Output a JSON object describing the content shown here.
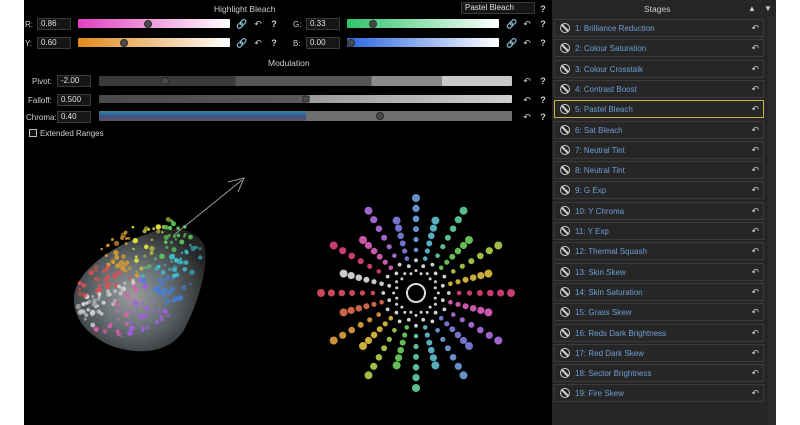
{
  "header": {
    "title": "Highlight Bleach",
    "preset_value": "Pastel Bleach",
    "help": "?"
  },
  "channels": {
    "r": {
      "label": "R:",
      "value": "0.86",
      "gradient_from": "#e040c0",
      "gradient_to": "#ffffff",
      "level": 0.46
    },
    "g": {
      "label": "G:",
      "value": "0.33",
      "gradient_from": "#2ec46a",
      "gradient_to": "#ffffff",
      "level": 0.17
    },
    "y": {
      "label": "Y:",
      "value": "0.60",
      "gradient_from": "#e08a1a",
      "gradient_to": "#ffffff",
      "level": 0.3
    },
    "b": {
      "label": "B:",
      "value": "0.00",
      "gradient_from": "#2a66e0",
      "gradient_to": "#ffffff",
      "level": 0.0
    }
  },
  "modulation": {
    "title": "Modulation",
    "pivot": {
      "label": "Pivot:",
      "value": "-2.00",
      "level": 0.16
    },
    "falloff": {
      "label": "Falloff:",
      "value": "0.500",
      "level": 0.5
    },
    "chroma": {
      "label": "Chroma:",
      "value": "0.40",
      "level": 0.68
    }
  },
  "extended_ranges": {
    "label": "Extended Ranges",
    "checked": false
  },
  "icons": {
    "link": "link-icon",
    "undo": "undo-icon",
    "help": "help-icon",
    "disabled": "disabled-icon"
  },
  "stages": {
    "title": "Stages",
    "up": "▲",
    "down": "▼",
    "selected_index": 4,
    "items": [
      "1: Brilliance Reduction",
      "2: Colour Saturation",
      "3: Colour Crosstalk",
      "4: Contrast Boost",
      "5: Pastel Bleach",
      "6: Sat Bleach",
      "7: Neutral Tint",
      "8: Neutral Tint",
      "9: G Exp",
      "10: Y Chroma",
      "11: Y Exp",
      "12: Thermal Squash",
      "13: Skin Skew",
      "14: Skin Saturation",
      "15: Grass Skew",
      "16: Reds Dark Brightness",
      "17: Red Dark Skew",
      "18: Sector Brightness",
      "19: Fire Skew"
    ]
  },
  "colors": {
    "accent_selected": "#c9b24a",
    "stage_text": "#6f9ed6",
    "panel_bg": "#262626"
  }
}
